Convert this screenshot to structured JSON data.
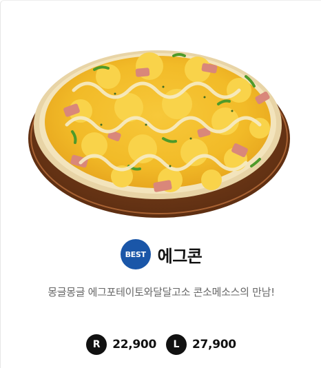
{
  "product": {
    "badge": "BEST",
    "name": "에그콘",
    "description": "몽글몽글 에그포테이토와달달고소 콘소메소스의 만남!",
    "image_alt": "에그콘 pizza"
  },
  "prices": [
    {
      "size": "R",
      "price": "22,900"
    },
    {
      "size": "L",
      "price": "27,900"
    }
  ],
  "colors": {
    "best_badge": "#1a56a8",
    "size_badge": "#111111",
    "description_text": "#666666"
  }
}
